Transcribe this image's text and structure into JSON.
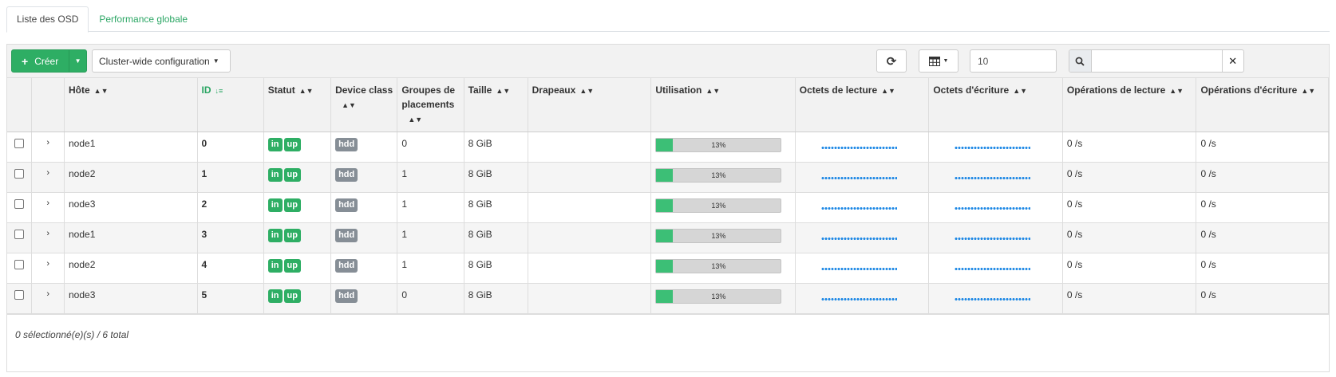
{
  "tabs": [
    {
      "label": "Liste des OSD",
      "active": true
    },
    {
      "label": "Performance globale",
      "active": false
    }
  ],
  "toolbar": {
    "create_label": "Créer",
    "cluster_config_label": "Cluster-wide configuration",
    "page_size": "10",
    "search_value": ""
  },
  "table": {
    "columns": [
      {
        "key": "host",
        "label": "Hôte",
        "sortable": true
      },
      {
        "key": "id",
        "label": "ID",
        "sortable": true,
        "sorted": "asc"
      },
      {
        "key": "status",
        "label": "Statut",
        "sortable": true
      },
      {
        "key": "device_class",
        "label": "Device class",
        "sortable": true
      },
      {
        "key": "pgs",
        "label": "Groupes de placements",
        "sortable": true
      },
      {
        "key": "size",
        "label": "Taille",
        "sortable": true
      },
      {
        "key": "flags",
        "label": "Drapeaux",
        "sortable": true
      },
      {
        "key": "usage",
        "label": "Utilisation",
        "sortable": true
      },
      {
        "key": "read_bytes",
        "label": "Octets de lecture",
        "sortable": true
      },
      {
        "key": "write_bytes",
        "label": "Octets d'écriture",
        "sortable": true
      },
      {
        "key": "read_ops",
        "label": "Opérations de lecture",
        "sortable": true
      },
      {
        "key": "write_ops",
        "label": "Opérations d'écriture",
        "sortable": true
      }
    ],
    "rows": [
      {
        "host": "node1",
        "id": "0",
        "status": [
          "in",
          "up"
        ],
        "device_class": "hdd",
        "pgs": "0",
        "size": "8 GiB",
        "flags": "",
        "usage": "13%",
        "usage_fraction": 0.13,
        "read_ops": "0 /s",
        "write_ops": "0 /s"
      },
      {
        "host": "node2",
        "id": "1",
        "status": [
          "in",
          "up"
        ],
        "device_class": "hdd",
        "pgs": "1",
        "size": "8 GiB",
        "flags": "",
        "usage": "13%",
        "usage_fraction": 0.13,
        "read_ops": "0 /s",
        "write_ops": "0 /s"
      },
      {
        "host": "node3",
        "id": "2",
        "status": [
          "in",
          "up"
        ],
        "device_class": "hdd",
        "pgs": "1",
        "size": "8 GiB",
        "flags": "",
        "usage": "13%",
        "usage_fraction": 0.13,
        "read_ops": "0 /s",
        "write_ops": "0 /s"
      },
      {
        "host": "node1",
        "id": "3",
        "status": [
          "in",
          "up"
        ],
        "device_class": "hdd",
        "pgs": "1",
        "size": "8 GiB",
        "flags": "",
        "usage": "13%",
        "usage_fraction": 0.13,
        "read_ops": "0 /s",
        "write_ops": "0 /s"
      },
      {
        "host": "node2",
        "id": "4",
        "status": [
          "in",
          "up"
        ],
        "device_class": "hdd",
        "pgs": "1",
        "size": "8 GiB",
        "flags": "",
        "usage": "13%",
        "usage_fraction": 0.13,
        "read_ops": "0 /s",
        "write_ops": "0 /s"
      },
      {
        "host": "node3",
        "id": "5",
        "status": [
          "in",
          "up"
        ],
        "device_class": "hdd",
        "pgs": "0",
        "size": "8 GiB",
        "flags": "",
        "usage": "13%",
        "usage_fraction": 0.13,
        "read_ops": "0 /s",
        "write_ops": "0 /s"
      }
    ]
  },
  "footer": {
    "summary": "0 sélectionné(e)(s) / 6 total"
  },
  "colors": {
    "accent": "#2eae64",
    "sparkline": "#1e88e5",
    "badge_gray": "#868e96"
  }
}
